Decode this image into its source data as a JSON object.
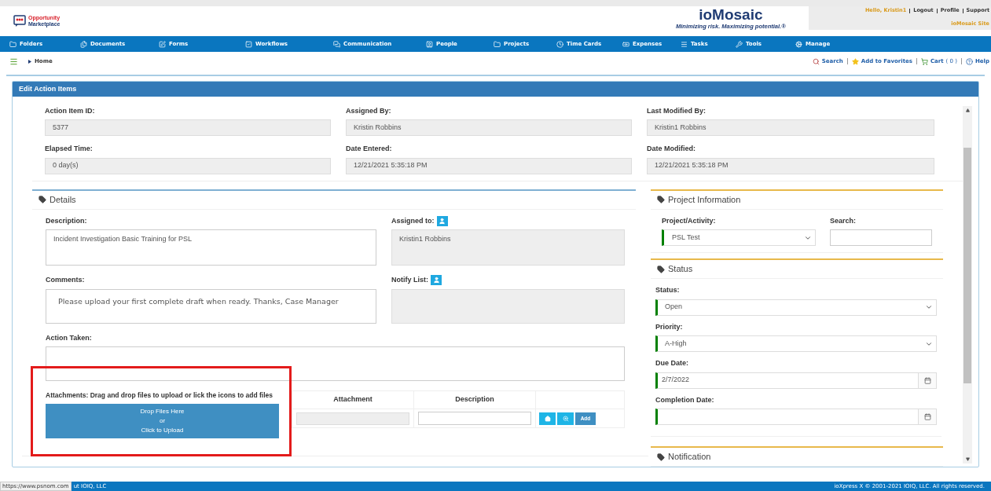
{
  "header": {
    "logo_lines": [
      "Opportunity",
      "Marketplace"
    ],
    "brand": "ioMosaic",
    "tagline": "Minimizing risk. Maximizing potential.®",
    "greeting": "Hello, Kristin1",
    "links": [
      "Logout",
      "Profile",
      "Support"
    ],
    "site_link": "ioMosaic Site"
  },
  "nav": [
    "Folders",
    "Documents",
    "Forms",
    "Workflows",
    "Communication",
    "People",
    "Projects",
    "Time Cards",
    "Expenses",
    "Tasks",
    "Tools",
    "Manage"
  ],
  "breadcrumb": "Home",
  "toolbar": {
    "search": "Search",
    "favorites": "Add to Favorites",
    "cart": "Cart",
    "cart_count": "( 0 )",
    "help": "Help"
  },
  "panel_title": "Edit Action Items",
  "summary": [
    {
      "label": "Action Item ID:",
      "value": "5377"
    },
    {
      "label": "Assigned By:",
      "value": "Kristin Robbins"
    },
    {
      "label": "Last Modified By:",
      "value": "Kristin1 Robbins"
    },
    {
      "label": "Elapsed Time:",
      "value": "0 day(s)"
    },
    {
      "label": "Date Entered:",
      "value": "12/21/2021 5:35:18 PM"
    },
    {
      "label": "Date Modified:",
      "value": "12/21/2021 5:35:18 PM"
    }
  ],
  "details": {
    "title": "Details",
    "description": {
      "label": "Description:",
      "value": "Incident Investigation Basic Training for PSL"
    },
    "assigned_to": {
      "label": "Assigned to:",
      "value": "Kristin1 Robbins"
    },
    "comments": {
      "label": "Comments:",
      "value": "Please upload your first complete draft when ready. Thanks, Case Manager"
    },
    "notify_list": {
      "label": "Notify List:"
    },
    "action_taken": {
      "label": "Action Taken:"
    },
    "attachments": {
      "label": "Attachments: Drag and drop files to upload or lick the icons to add files",
      "upload_lines": [
        "Drop Files Here",
        "or",
        "Click to Upload"
      ],
      "columns": [
        "Attachment",
        "Description"
      ],
      "add_button": "Add"
    }
  },
  "project": {
    "title": "Project Information",
    "activity": {
      "label": "Project/Activity:",
      "value": "PSL Test"
    },
    "search": {
      "label": "Search:"
    }
  },
  "status": {
    "title": "Status",
    "fields": [
      {
        "label": "Status:",
        "value": "Open",
        "kind": "select"
      },
      {
        "label": "Priority:",
        "value": "A-High",
        "kind": "select"
      },
      {
        "label": "Due Date:",
        "value": "2/7/2022",
        "kind": "date"
      },
      {
        "label": "Completion Date:",
        "kind": "date"
      }
    ]
  },
  "notification": {
    "title": "Notification"
  },
  "footer": {
    "left": "ut IOIQ, LLC",
    "right": "ioXpress X © 2001-2021 IOIQ, LLC. All rights reserved.",
    "link_preview": "https://www.psnom.com"
  }
}
